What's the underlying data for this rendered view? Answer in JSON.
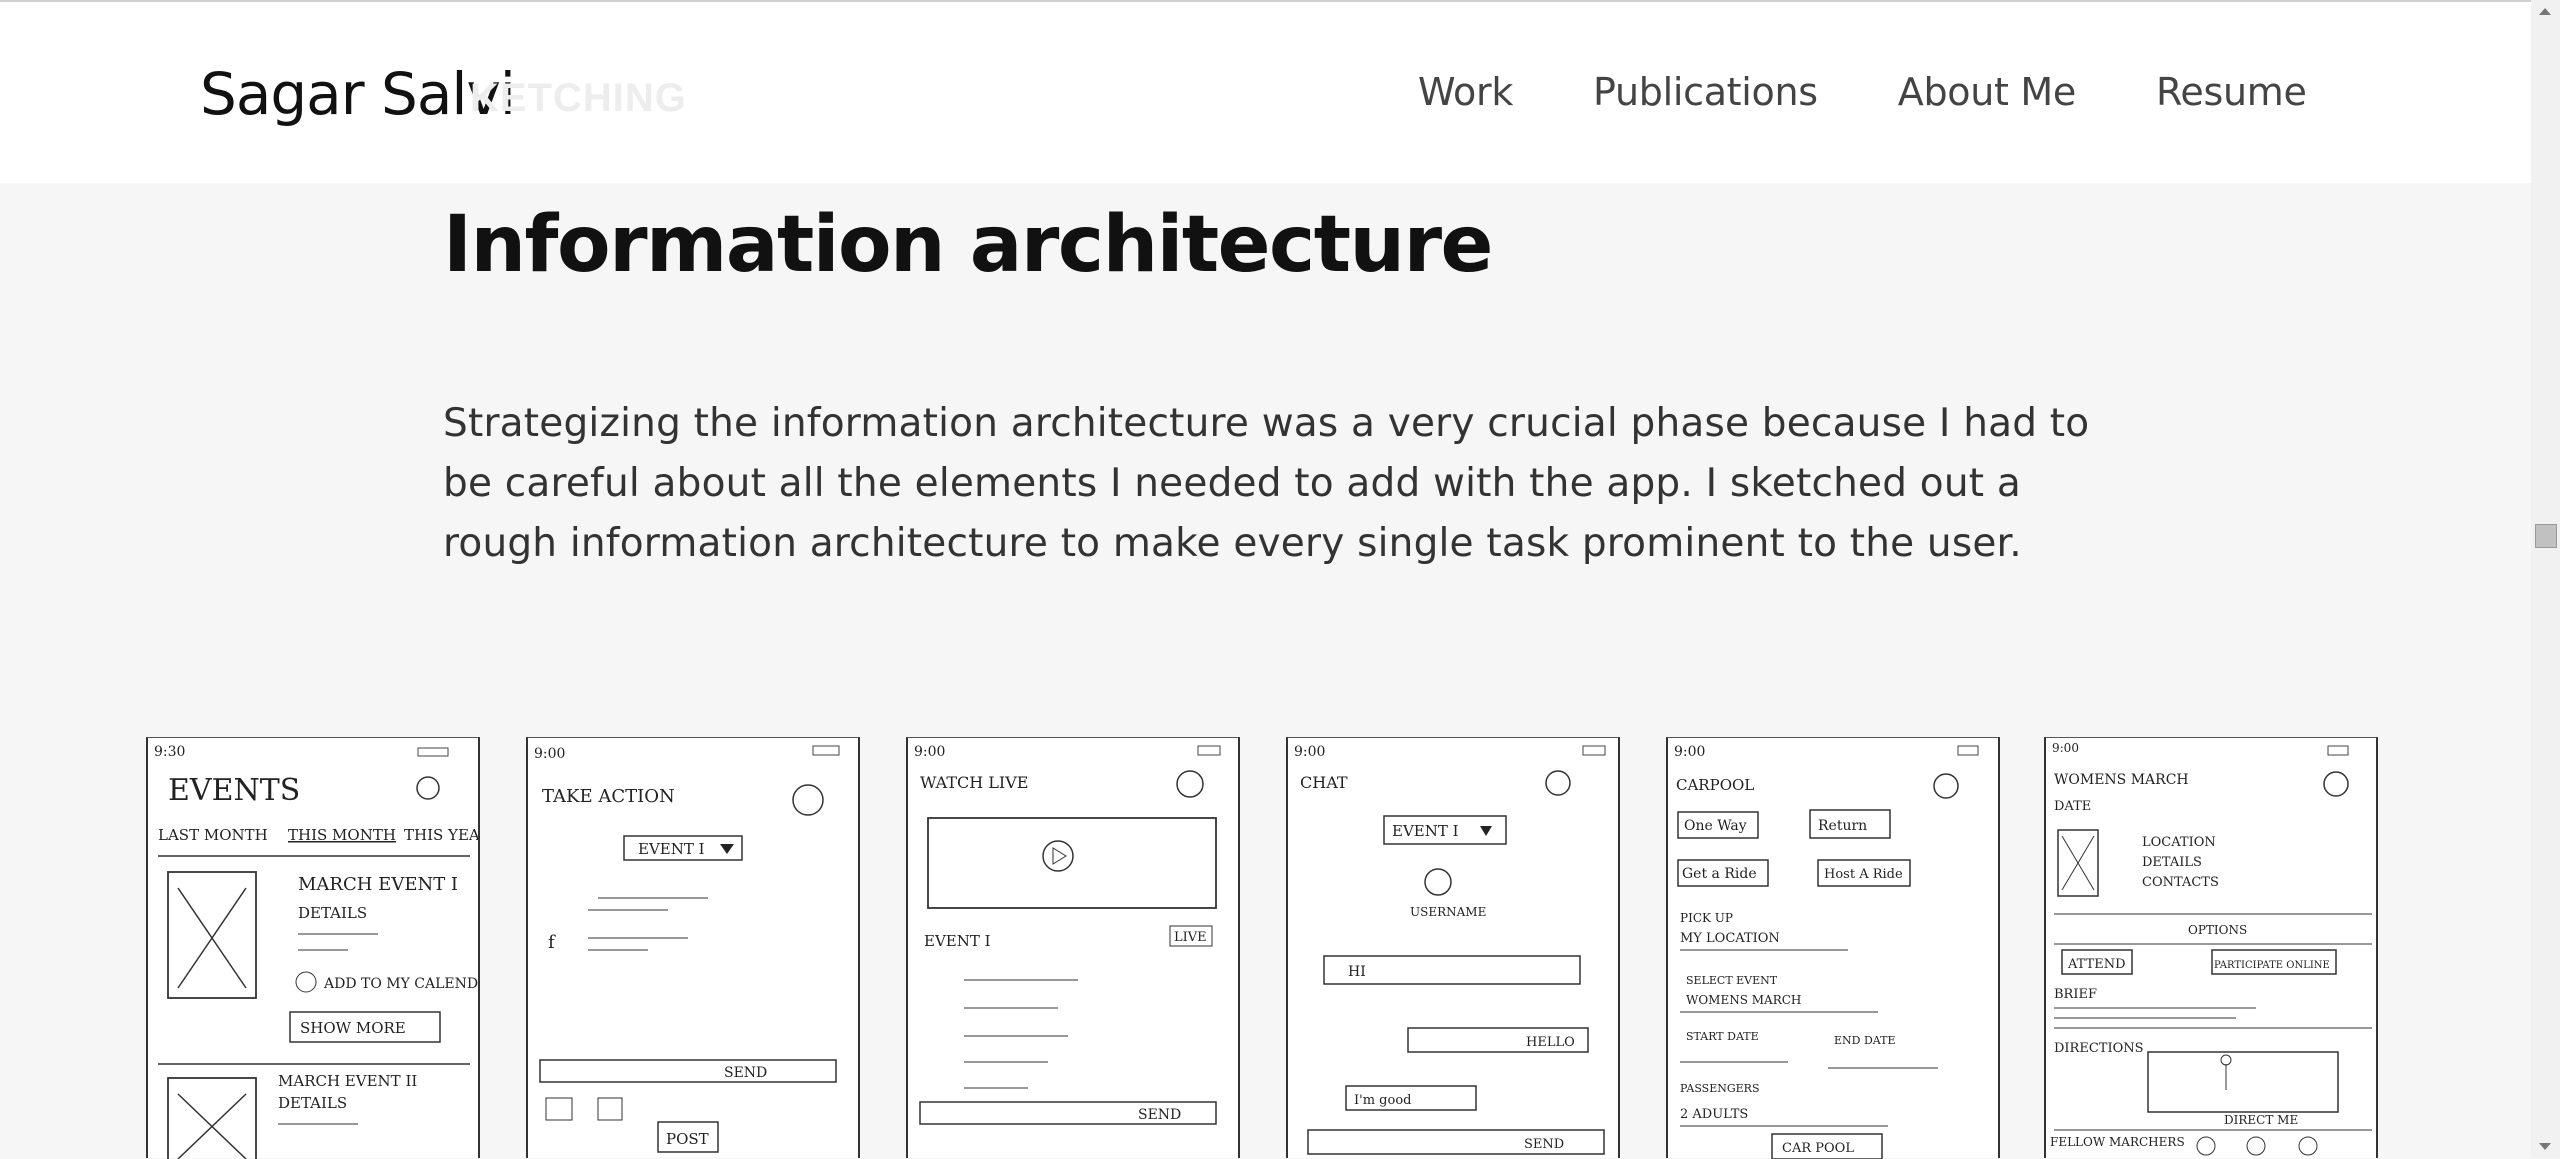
{
  "header": {
    "brand": "Sagar Salvi",
    "brand_ghost": "KETCHING",
    "nav": [
      "Work",
      "Publications",
      "About Me",
      "Resume"
    ]
  },
  "main": {
    "heading": "Information architecture",
    "paragraph": "Strategizing the information architecture was a very crucial phase because I had to be careful about all the elements I needed to add with the app. I sketched out a rough information architecture to make every single task prominent to the user."
  },
  "sketches": [
    {
      "time": "9:30",
      "title": "EVENTS",
      "tabs": [
        "LAST MONTH",
        "THIS MONTH",
        "THIS YEAR"
      ],
      "event1": "MARCH EVENT I",
      "details": "DETAILS",
      "add": "ADD TO MY CALENDAR",
      "show_more": "SHOW MORE",
      "event2": "MARCH EVENT II"
    },
    {
      "time": "9:00",
      "title": "TAKE ACTION",
      "dropdown": "EVENT I",
      "send": "SEND",
      "post": "POST"
    },
    {
      "time": "9:00",
      "title": "WATCH LIVE",
      "event": "EVENT I",
      "live": "LIVE",
      "send": "SEND"
    },
    {
      "time": "9:00",
      "title": "CHAT",
      "dropdown": "EVENT I",
      "username": "USERNAME",
      "msg1": "HI",
      "msg2": "HELLO",
      "msg3": "I'm good",
      "send": "SEND"
    },
    {
      "time": "9:00",
      "title": "CARPOOL",
      "one_way": "One Way",
      "return": "Return",
      "get_ride": "Get a Ride",
      "host_ride": "Host A Ride",
      "pickup": "PICK UP",
      "my_location": "MY LOCATION",
      "select_event": "SELECT EVENT",
      "womens_march": "WOMENS MARCH",
      "start_date": "START DATE",
      "end_date": "END DATE",
      "passengers": "PASSENGERS",
      "adults": "2 ADULTS",
      "carpool_btn": "CAR POOL"
    },
    {
      "time": "9:00",
      "title": "WOMENS MARCH",
      "date": "DATE",
      "location": "LOCATION",
      "details": "DETAILS",
      "contacts": "CONTACTS",
      "options": "OPTIONS",
      "attend": "ATTEND",
      "participate": "PARTICIPATE ONLINE",
      "brief": "BRIEF",
      "directions": "DIRECTIONS",
      "direct_me": "DIRECT ME",
      "fellow": "FELLOW MARCHERS"
    }
  ]
}
